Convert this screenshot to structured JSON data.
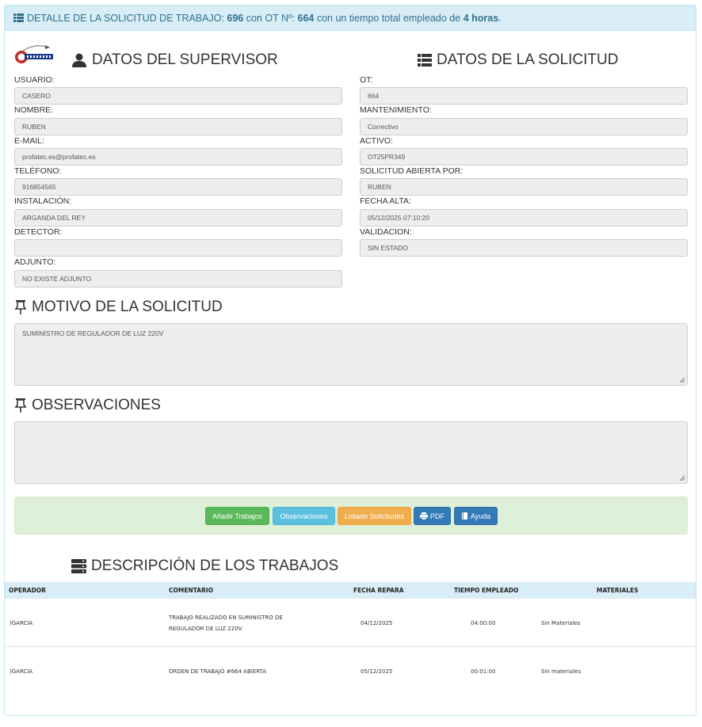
{
  "header": {
    "part1": "DETALLE DE LA SOLICITUD DE TRABAJO: ",
    "solicitud": "696",
    "part2": " con OT Nº: ",
    "ot": "664",
    "part3": " con un tiempo total empleado de ",
    "horas": "4 horas",
    "part4": "."
  },
  "supervisor": {
    "title": "DATOS DEL SUPERVISOR",
    "fields": [
      {
        "label": "USUARIO:",
        "value": "CASERO"
      },
      {
        "label": "NOMBRE:",
        "value": "RUBEN"
      },
      {
        "label": "E-MAIL:",
        "value": "profatec.es@profatec.es"
      },
      {
        "label": "TELÉFONO:",
        "value": "916854565"
      },
      {
        "label": "INSTALACIÓN:",
        "value": "ARGANDA DEL REY"
      },
      {
        "label": "DETECTOR:",
        "value": ""
      },
      {
        "label": "ADJUNTO:",
        "value": "NO EXISTE ADJUNTO"
      }
    ]
  },
  "solicitud": {
    "title": "DATOS DE LA SOLICITUD",
    "fields": [
      {
        "label": "OT:",
        "value": "664"
      },
      {
        "label": "MANTENIMIENTO:",
        "value": "Correctivo"
      },
      {
        "label": "ACTIVO:",
        "value": "OT25PR349"
      },
      {
        "label": "SOLICITUD ABIERTA POR:",
        "value": "RUBEN"
      },
      {
        "label": "FECHA ALTA:",
        "value": "05/12/2025 07:10:20"
      },
      {
        "label": "VALIDACION:",
        "value": "SIN ESTADO"
      }
    ]
  },
  "motivo": {
    "title": "MOTIVO DE LA SOLICITUD",
    "text": "SUMINISTRO DE REGULADOR DE LUZ 220V"
  },
  "observaciones": {
    "title": "OBSERVACIONES",
    "text": ""
  },
  "buttons": {
    "add": "Añadir Trabajos",
    "obs": "Observaciones",
    "list": "Listado Solicitudes",
    "pdf": "PDF",
    "help": "Ayuda"
  },
  "colors": {
    "add": "#5cb85c",
    "obs": "#5bc0de",
    "list": "#f0ad4e",
    "pdf": "#337ab7",
    "help": "#337ab7"
  },
  "trabajos": {
    "title": "DESCRIPCIÓN DE LOS TRABAJOS",
    "columns": [
      "OPERADOR",
      "COMENTARIO",
      "FECHA REPARA",
      "TIEMPO EMPLEADO",
      "MATERIALES"
    ],
    "rows": [
      {
        "operador": ")GARCIA",
        "comentario1": "TRABAJO REALIZADO EN SUMINISTRO DE",
        "comentario2": "REGULADOR DE LUZ 220V.",
        "fecha": "04/12/2025",
        "tiempo": "04:00:00",
        "materiales": "Sin Materiales"
      },
      {
        "operador": ")GARCIA",
        "comentario1": "ORDEN DE TRABAJO #664 ABIERTA",
        "comentario2": "",
        "fecha": "05/12/2025",
        "tiempo": "00:01:00",
        "materiales": "Sin materiales"
      }
    ]
  }
}
